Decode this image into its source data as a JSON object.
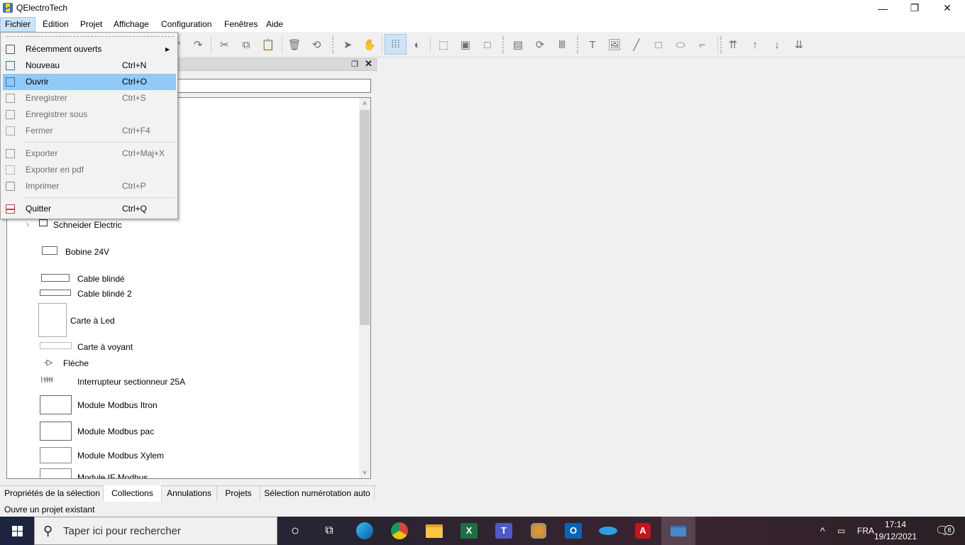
{
  "window": {
    "title": "QElectroTech",
    "controls": {
      "minimize": "—",
      "restore": "❐",
      "close": "✕"
    }
  },
  "menubar": [
    {
      "label": "Fichier",
      "active": true
    },
    {
      "label": "Édition"
    },
    {
      "label": "Projet"
    },
    {
      "label": "Affichage"
    },
    {
      "label": "Configuration"
    },
    {
      "label": "Fenêtres"
    },
    {
      "label": "Aide"
    }
  ],
  "file_menu": {
    "items": [
      {
        "label": "Récemment ouverts",
        "shortcut": "",
        "icon": "recent-icon",
        "submenu": true,
        "enabled": true
      },
      {
        "label": "Nouveau",
        "shortcut": "Ctrl+N",
        "icon": "new-project-icon",
        "enabled": true
      },
      {
        "label": "Ouvrir",
        "shortcut": "Ctrl+O",
        "icon": "open-folder-icon",
        "enabled": true,
        "highlighted": true
      },
      {
        "label": "Enregistrer",
        "shortcut": "Ctrl+S",
        "icon": "save-icon",
        "enabled": false
      },
      {
        "label": "Enregistrer sous",
        "shortcut": "",
        "icon": "save-as-icon",
        "enabled": false
      },
      {
        "label": "Fermer",
        "shortcut": "Ctrl+F4",
        "icon": "close-project-icon",
        "enabled": false
      },
      {
        "label": "Exporter",
        "shortcut": "Ctrl+Maj+X",
        "icon": "export-icon",
        "enabled": false
      },
      {
        "label": "Exporter en pdf",
        "shortcut": "",
        "icon": "export-pdf-icon",
        "enabled": false
      },
      {
        "label": "Imprimer",
        "shortcut": "Ctrl+P",
        "icon": "print-icon",
        "enabled": false
      },
      {
        "label": "Quitter",
        "shortcut": "Ctrl+Q",
        "icon": "quit-icon",
        "enabled": true
      }
    ],
    "submenu_arrow": "▶"
  },
  "toolbar": {
    "icons": [
      "undo",
      "redo",
      "cut",
      "copy",
      "paste",
      "delete",
      "rotate",
      "select",
      "hand",
      "grid",
      "contrast",
      "zoom-fit",
      "zoom-content",
      "zoom-reset",
      "edit-folio",
      "conductor",
      "terminal-strip",
      "add-text",
      "add-image",
      "add-line",
      "add-rectangle",
      "add-ellipse",
      "add-polyline",
      "raise-top",
      "raise",
      "lower",
      "lower-bottom"
    ]
  },
  "collections_panel": {
    "filter_value": "",
    "tree": [
      {
        "label": "Schneider Electric",
        "type": "folder"
      },
      {
        "label": "Bobine 24V"
      },
      {
        "label": "Cable blindé"
      },
      {
        "label": "Cable blindé 2"
      },
      {
        "label": "Carte à Led"
      },
      {
        "label": "Carte à voyant"
      },
      {
        "label": "Fléche"
      },
      {
        "label": "Interrupteur sectionneur 25A"
      },
      {
        "label": "Module Modbus Itron"
      },
      {
        "label": "Module Modbus pac"
      },
      {
        "label": "Module Modbus Xylem"
      },
      {
        "label": "Module IF Modbus"
      }
    ],
    "scroll": {
      "up": "˄",
      "down": "˅"
    },
    "dock_float": "❐",
    "dock_close": "✕"
  },
  "bottom_tabs": [
    {
      "label": "Propriétés de la sélection"
    },
    {
      "label": "Collections",
      "selected": true
    },
    {
      "label": "Annulations"
    },
    {
      "label": "Projets"
    },
    {
      "label": "Sélection numérotation auto"
    }
  ],
  "status_bar": {
    "text": "Ouvre un projet existant"
  },
  "taskbar": {
    "search_placeholder": "Taper ici pour rechercher",
    "apps": [
      "cortana",
      "task-view",
      "edge",
      "chrome",
      "file-explorer",
      "excel",
      "teams",
      "app-orange",
      "outlook",
      "sync-app",
      "acrobat",
      "qelectrotech"
    ],
    "tray": {
      "language": "FRA",
      "time": "17:14",
      "date": "19/12/2021",
      "notifications": "8"
    }
  }
}
